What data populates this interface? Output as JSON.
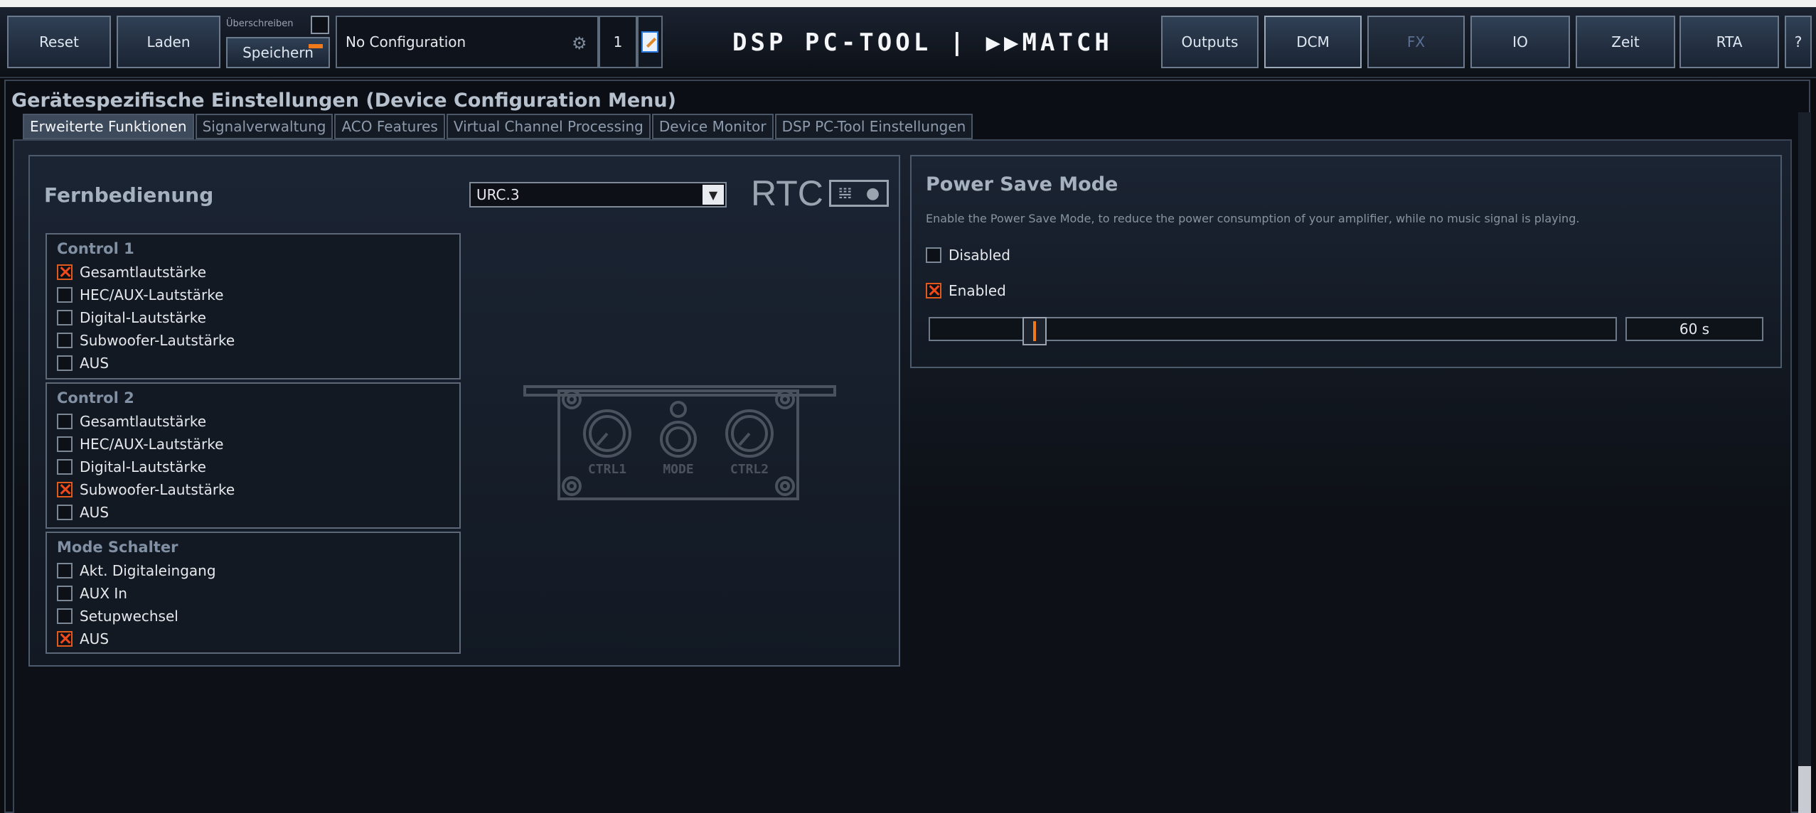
{
  "toolbar": {
    "reset": "Reset",
    "laden": "Laden",
    "ueberschreiben": "Überschreiben",
    "speichern": "Speichern",
    "config": "No Configuration",
    "slot": "1",
    "logo": "DSP PC-TOOL | ▶▶MATCH",
    "nav": [
      "Outputs",
      "DCM",
      "FX",
      "IO",
      "Zeit",
      "RTA",
      "?"
    ],
    "active_nav": "DCM"
  },
  "page": {
    "title": "Gerätespezifische Einstellungen (Device Configuration Menu)",
    "tabs": [
      "Erweiterte Funktionen",
      "Signalverwaltung",
      "ACO Features",
      "Virtual Channel Processing",
      "Device Monitor",
      "DSP PC-Tool Einstellungen"
    ],
    "active_tab": "Erweiterte Funktionen"
  },
  "remote": {
    "title": "Fernbedienung",
    "selected": "URC.3",
    "logo_text": "RTC",
    "control1": {
      "title": "Control 1",
      "options": [
        {
          "label": "Gesamtlautstärke",
          "checked": true
        },
        {
          "label": "HEC/AUX-Lautstärke",
          "checked": false
        },
        {
          "label": "Digital-Lautstärke",
          "checked": false
        },
        {
          "label": "Subwoofer-Lautstärke",
          "checked": false
        },
        {
          "label": "AUS",
          "checked": false
        }
      ]
    },
    "control2": {
      "title": "Control 2",
      "options": [
        {
          "label": "Gesamtlautstärke",
          "checked": false
        },
        {
          "label": "HEC/AUX-Lautstärke",
          "checked": false
        },
        {
          "label": "Digital-Lautstärke",
          "checked": false
        },
        {
          "label": "Subwoofer-Lautstärke",
          "checked": true
        },
        {
          "label": "AUS",
          "checked": false
        }
      ]
    },
    "mode": {
      "title": "Mode Schalter",
      "options": [
        {
          "label": "Akt. Digitaleingang",
          "checked": false
        },
        {
          "label": "AUX In",
          "checked": false
        },
        {
          "label": "Setupwechsel",
          "checked": false
        },
        {
          "label": "AUS",
          "checked": true
        }
      ]
    },
    "device_labels": [
      "CTRL1",
      "MODE",
      "CTRL2"
    ]
  },
  "power": {
    "title": "Power Save Mode",
    "description": "Enable the Power Save Mode, to reduce the power consumption of your amplifier, while no music signal is playing.",
    "disabled_label": "Disabled",
    "enabled_label": "Enabled",
    "enabled": true,
    "slider_fraction": 0.06,
    "value": "60 s"
  },
  "colors": {
    "accent": "#f07a1a",
    "check": "#f04a1a"
  }
}
